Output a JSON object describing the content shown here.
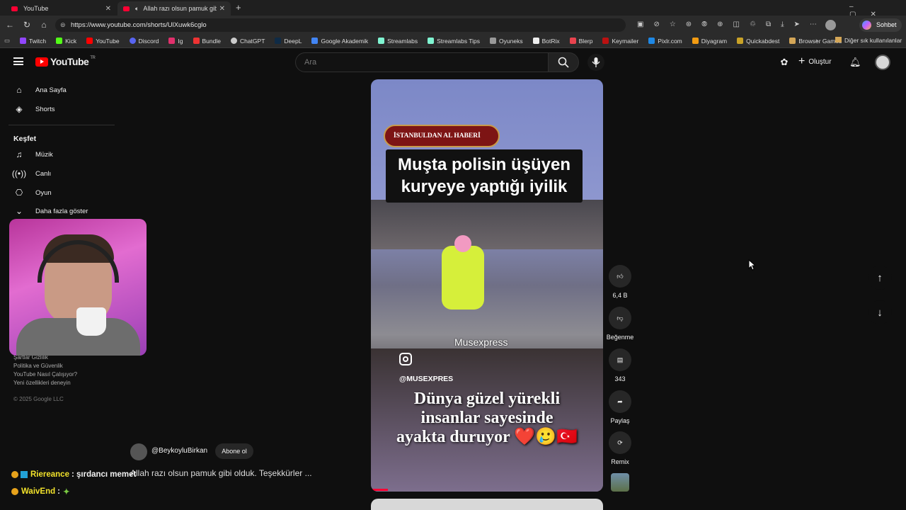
{
  "browser": {
    "tabs": [
      {
        "title": "YouTube"
      },
      {
        "title": "Allah razı olsun pamuk gibi o"
      }
    ],
    "url": "https://www.youtube.com/shorts/UlXuwk6cglo",
    "copilot_label": "Sohbet et",
    "bookmarks": [
      "Twitch",
      "Kick",
      "YouTube",
      "Discord",
      "Ig",
      "Bundle",
      "ChatGPT",
      "DeepL",
      "Google Akademik",
      "Streamlabs",
      "Streamlabs Tips",
      "Oyuneks",
      "BotRix",
      "Blerp",
      "Keymailer",
      "Pixlr.com",
      "Diyagram",
      "Quickabdest",
      "Browser Games"
    ],
    "other_bookmarks": "Diğer sık kullanılanlar"
  },
  "youtube": {
    "logo_text": "YouTube",
    "region": "TR",
    "search_placeholder": "Ara",
    "create_label": "Oluştur",
    "sidebar": {
      "main": [
        {
          "label": "Ana Sayfa"
        },
        {
          "label": "Shorts"
        }
      ],
      "explore_title": "Keşfet",
      "explore": [
        {
          "label": "Müzik"
        },
        {
          "label": "Canlı"
        },
        {
          "label": "Oyun"
        }
      ],
      "more_label": "Daha fazla göster",
      "footer": [
        "Şartlar  Gizlilik",
        "Politika ve Güvenlik",
        "YouTube Nasıl Çalışıyor?",
        "Yeni özellikleri deneyin"
      ],
      "copyright": "© 2025 Google LLC"
    },
    "short": {
      "badge": "İSTANBULDAN AL HABERİ",
      "headline_line1": "Muşta polisin üşüyen",
      "headline_line2": "kuryeye yaptığı iyilik",
      "watermark": "Musexpress",
      "instagram_handle": "@MUSEXPRES",
      "caption_line1": "Dünya güzel yürekli",
      "caption_line2": "insanlar sayesinde",
      "caption_line3": "ayakta duruyor ❤️🥲🇹🇷",
      "channel": "@BeykoyluBirkan",
      "subscribe_label": "Abone ol",
      "title": "Allah razı olsun pamuk gibi olduk. Teşekkürler ..."
    },
    "actions": {
      "likes": "6,4 B",
      "dislike_label": "Beğenme",
      "comments": "343",
      "share_label": "Paylaş",
      "remix_label": "Remix"
    }
  },
  "stream_chat": [
    {
      "user": "Riereance",
      "message": ": şırdancı memet",
      "color": "#f2e22b"
    },
    {
      "user": "WaivEnd",
      "message": ":",
      "color": "#f2e22b"
    }
  ]
}
